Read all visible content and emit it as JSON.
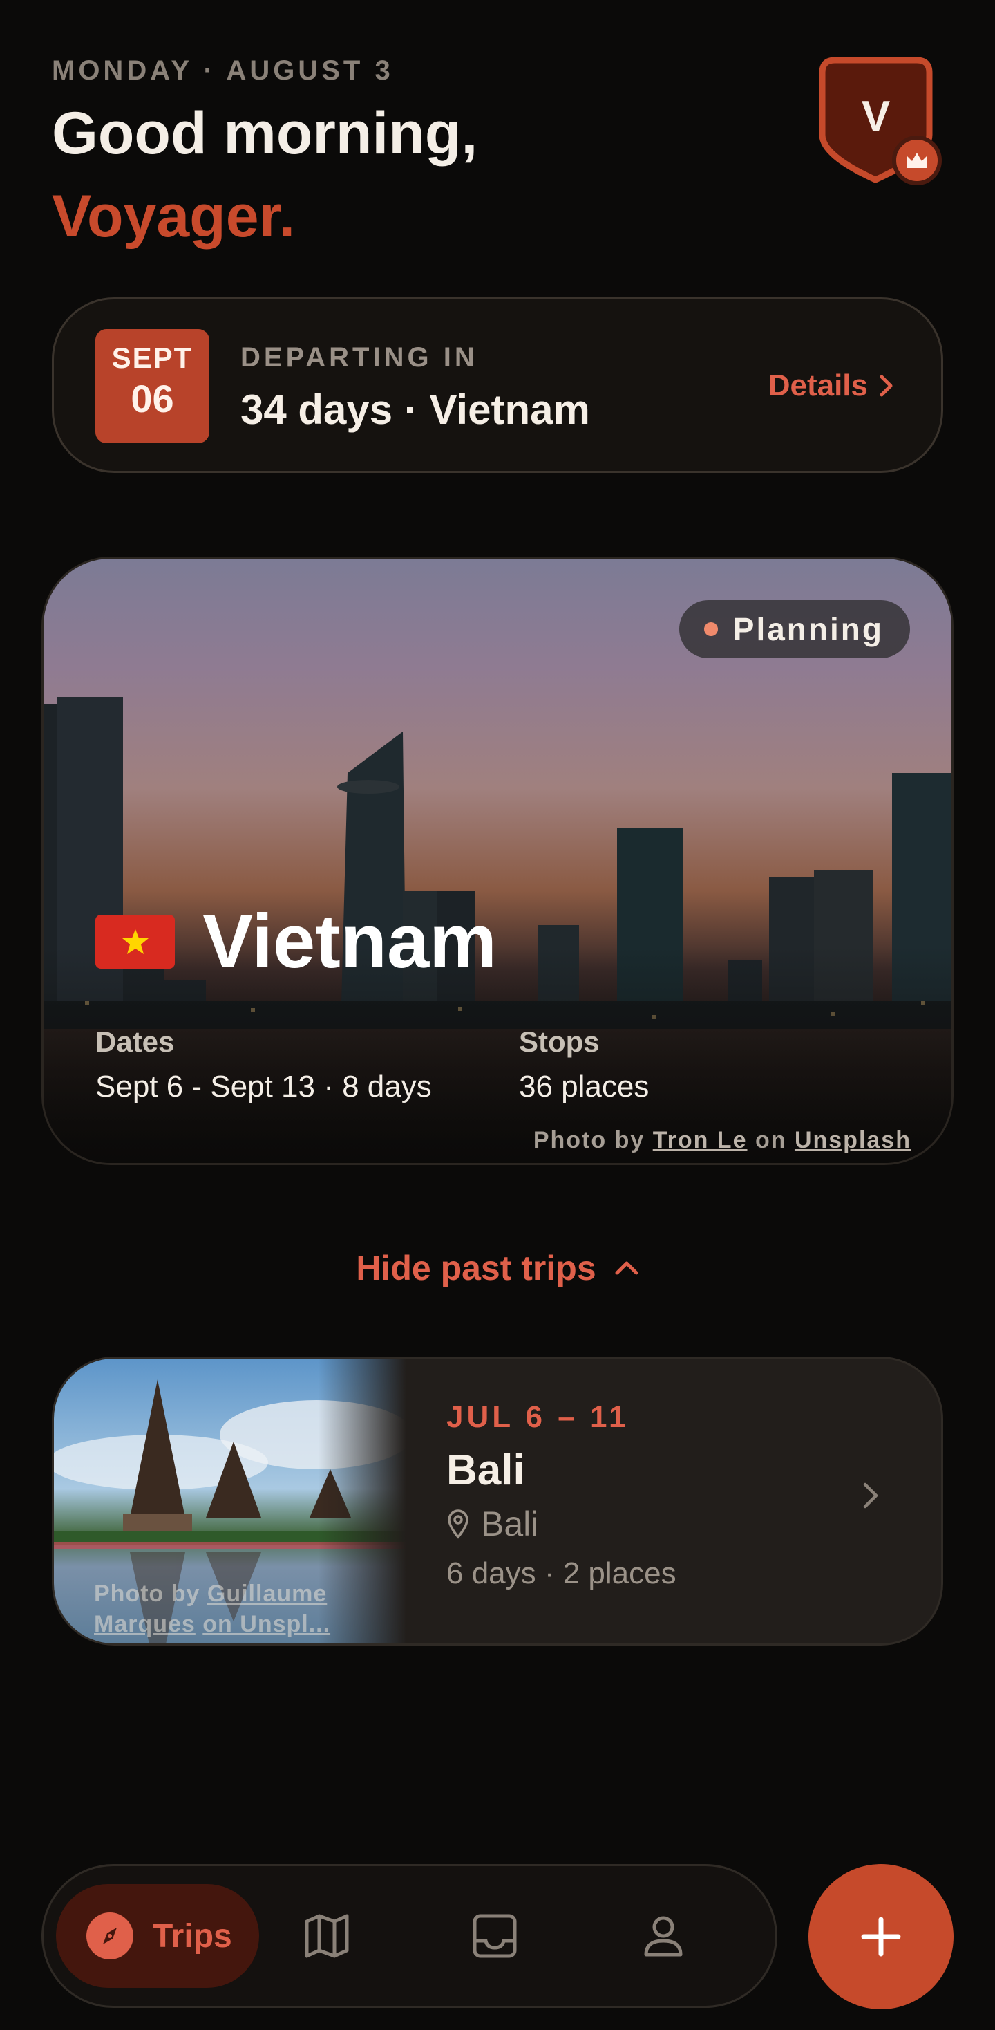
{
  "header": {
    "date": "MONDAY · AUGUST 3",
    "greeting": "Good morning,",
    "name": "Voyager.",
    "avatar_initial": "V"
  },
  "countdown": {
    "month": "SEPT",
    "day": "06",
    "label": "DEPARTING IN",
    "value": "34 days · Vietnam",
    "details_label": "Details"
  },
  "current_trip": {
    "status": "Planning",
    "name": "Vietnam",
    "dates_label": "Dates",
    "dates_value": "Sept 6 - Sept 13 · 8 days",
    "stops_label": "Stops",
    "stops_value": "36 places",
    "credit_prefix": "Photo by",
    "credit_author": "Tron Le",
    "credit_mid": "on",
    "credit_site": "Unsplash"
  },
  "toggle_label": "Hide past trips",
  "past_trips": [
    {
      "dates": "JUL 6 – 11",
      "name": "Bali",
      "location": "Bali",
      "meta": "6 days · 2 places",
      "credit_prefix": "Photo by",
      "credit_author": "Guillaume Marques",
      "credit_suffix": "on Unspl..."
    }
  ],
  "nav": {
    "trips_label": "Trips"
  },
  "colors": {
    "accent": "#c64a2b",
    "accent_text": "#e0604a",
    "background": "#0b0a09"
  }
}
